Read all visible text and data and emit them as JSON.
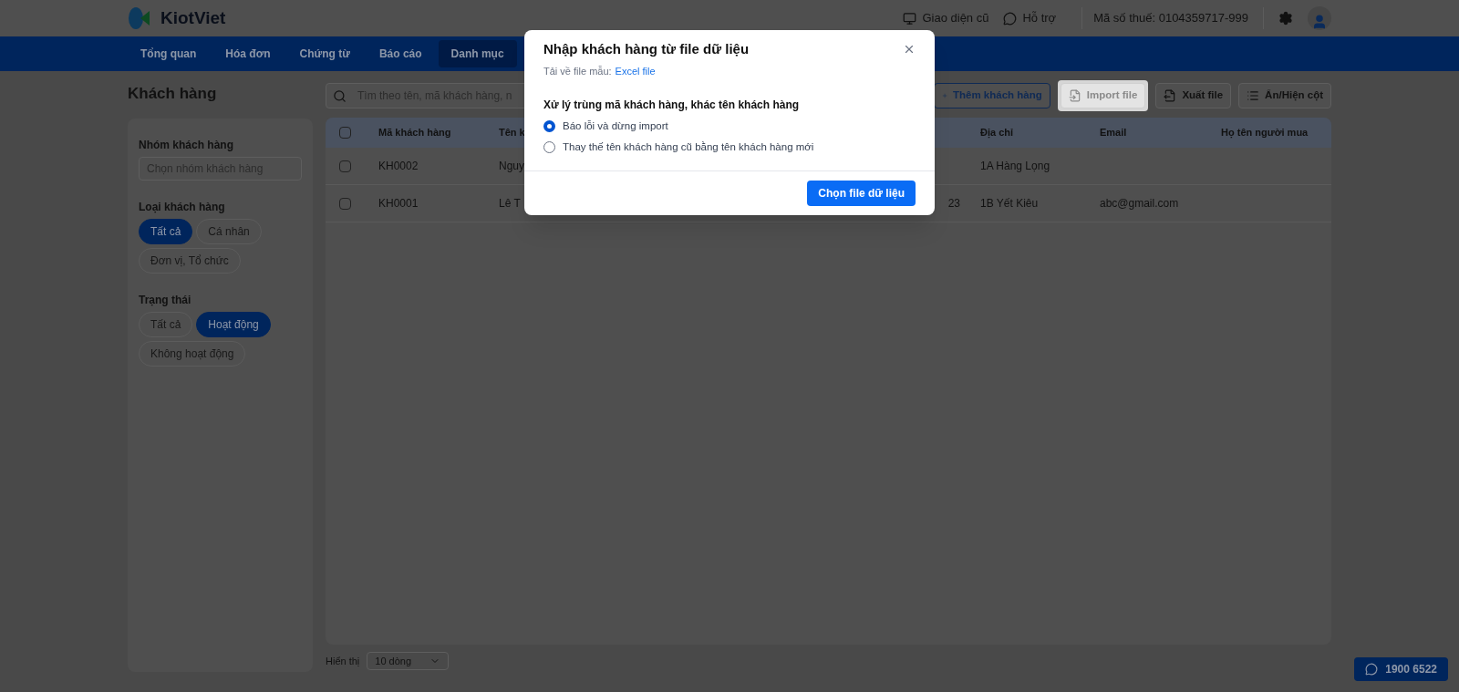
{
  "header": {
    "logo": "KiotViet",
    "links": [
      {
        "label": "Giao diện cũ",
        "kind": "monitor"
      },
      {
        "label": "Hỗ trợ",
        "kind": "chat"
      }
    ],
    "tax_code": "Mã số thuế: 0104359717-999"
  },
  "nav": [
    {
      "label": "Tổng quan",
      "selected": false
    },
    {
      "label": "Hóa đơn",
      "selected": false
    },
    {
      "label": "Chứng từ",
      "selected": false
    },
    {
      "label": "Báo cáo",
      "selected": false
    },
    {
      "label": "Danh mục",
      "selected": true
    }
  ],
  "page_title": "Khách hàng",
  "filters": {
    "group": {
      "label": "Nhóm khách hàng",
      "placeholder": "Chọn nhóm khách hàng"
    },
    "sections": [
      {
        "label": "Loại khách hàng",
        "options": [
          {
            "label": "Tất cả",
            "selected": true
          },
          {
            "label": "Cá nhân",
            "selected": false
          },
          {
            "label": "Đơn vị, Tổ chức",
            "selected": false
          }
        ]
      },
      {
        "label": "Trạng thái",
        "options": [
          {
            "label": "Tất cả",
            "selected": false
          },
          {
            "label": "Hoạt động",
            "selected": true
          },
          {
            "label": "Không hoạt động",
            "selected": false
          }
        ]
      }
    ]
  },
  "search": {
    "placeholder": "Tìm theo tên, mã khách hàng, n"
  },
  "toolbar": [
    {
      "label": "Thêm khách hàng",
      "kind": "add",
      "highlighted": false
    },
    {
      "label": "Import file",
      "kind": "import",
      "highlighted": true
    },
    {
      "label": "Xuất file",
      "kind": "export",
      "highlighted": false
    },
    {
      "label": "Ẩn/Hiện cột",
      "kind": "columns",
      "highlighted": false
    }
  ],
  "table": {
    "all_checked": false,
    "columns": [
      "Mã khách hàng",
      "Tên k",
      "",
      "Địa chỉ",
      "Email",
      "Họ tên người mua"
    ],
    "rows": [
      {
        "checked": false,
        "cells": [
          "KH0002",
          "Nguy",
          "",
          "1A Hàng Lọng",
          "",
          ""
        ]
      },
      {
        "checked": false,
        "cells": [
          "KH0001",
          "Lê T",
          "23",
          "1B Yết Kiêu",
          "abc@gmail.com",
          ""
        ]
      }
    ]
  },
  "footer": {
    "label": "Hiển thị",
    "page_size": "10 dòng"
  },
  "hotline": "1900 6522",
  "dialog": {
    "title": "Nhập khách hàng từ file dữ liệu",
    "template_label": "Tải về file mẫu:",
    "template_link": "Excel file",
    "question": "Xử lý trùng mã khách hàng, khác tên khách hàng",
    "options": [
      {
        "label": "Báo lỗi và dừng import",
        "selected": true
      },
      {
        "label": "Thay thế tên khách hàng cũ bằng tên khách hàng mới",
        "selected": false
      }
    ],
    "button": "Chọn file dữ liệu"
  }
}
